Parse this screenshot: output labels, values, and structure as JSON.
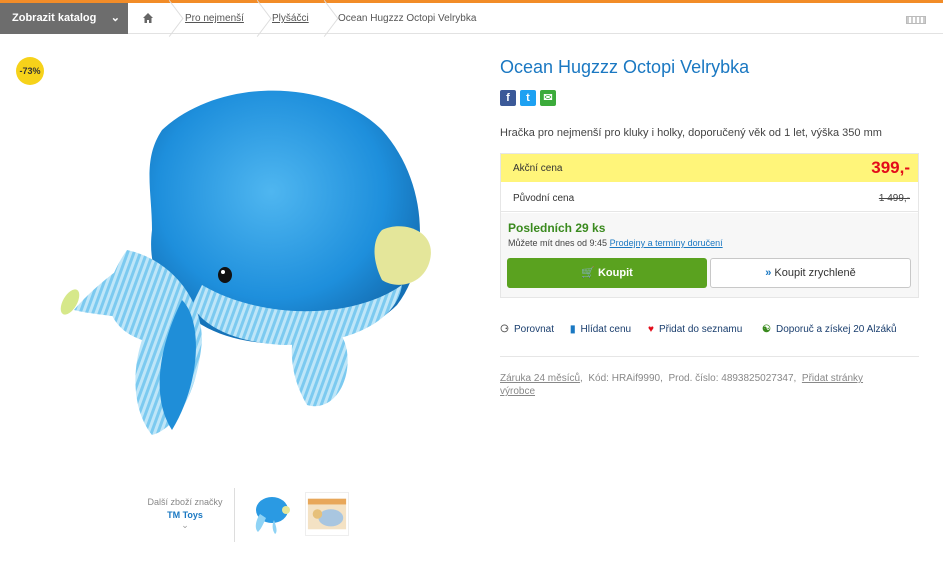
{
  "topbar": {
    "catalog_label": "Zobrazit katalog",
    "breadcrumb": [
      "Pro nejmenší",
      "Plyšáčci",
      "Ocean Hugzzz Octopi Velrybka"
    ]
  },
  "badge": {
    "discount": "-73%"
  },
  "product": {
    "title": "Ocean Hugzzz Octopi Velrybka",
    "description": "Hračka pro nejmenší pro kluky i holky, doporučený věk od 1 let, výška 350 mm",
    "share": {
      "facebook": "f",
      "twitter": "t",
      "email": "✉"
    }
  },
  "pricing": {
    "sale_label": "Akční cena",
    "sale_price": "399,-",
    "original_label": "Původní cena",
    "original_price": "1 499,-"
  },
  "availability": {
    "stock": "Posledních 29 ks",
    "pickup_text": "Můžete mít dnes od 9:45",
    "pickup_link": "Prodejny a termíny doručení"
  },
  "buttons": {
    "buy": "Koupit",
    "buy_fast": "Koupit zrychleně"
  },
  "actions": {
    "compare": "Porovnat",
    "watch_price": "Hlídat cenu",
    "add_list": "Přidat do seznamu",
    "recommend": "Doporuč a získej 20 Alzáků"
  },
  "info": {
    "warranty": "Záruka 24 měsíců",
    "code_label": "Kód: HRAif9990,",
    "prod_no": "Prod. číslo: 4893825027347,",
    "manufacturer_link": "Přidat stránky výrobce"
  },
  "brand": {
    "label": "Další zboží značky",
    "name": "TM Toys"
  },
  "colors": {
    "accent_blue": "#1a78c2",
    "price_red": "#e30c1a",
    "buy_green": "#5aa21f",
    "highlight_yellow": "#fff57a"
  }
}
